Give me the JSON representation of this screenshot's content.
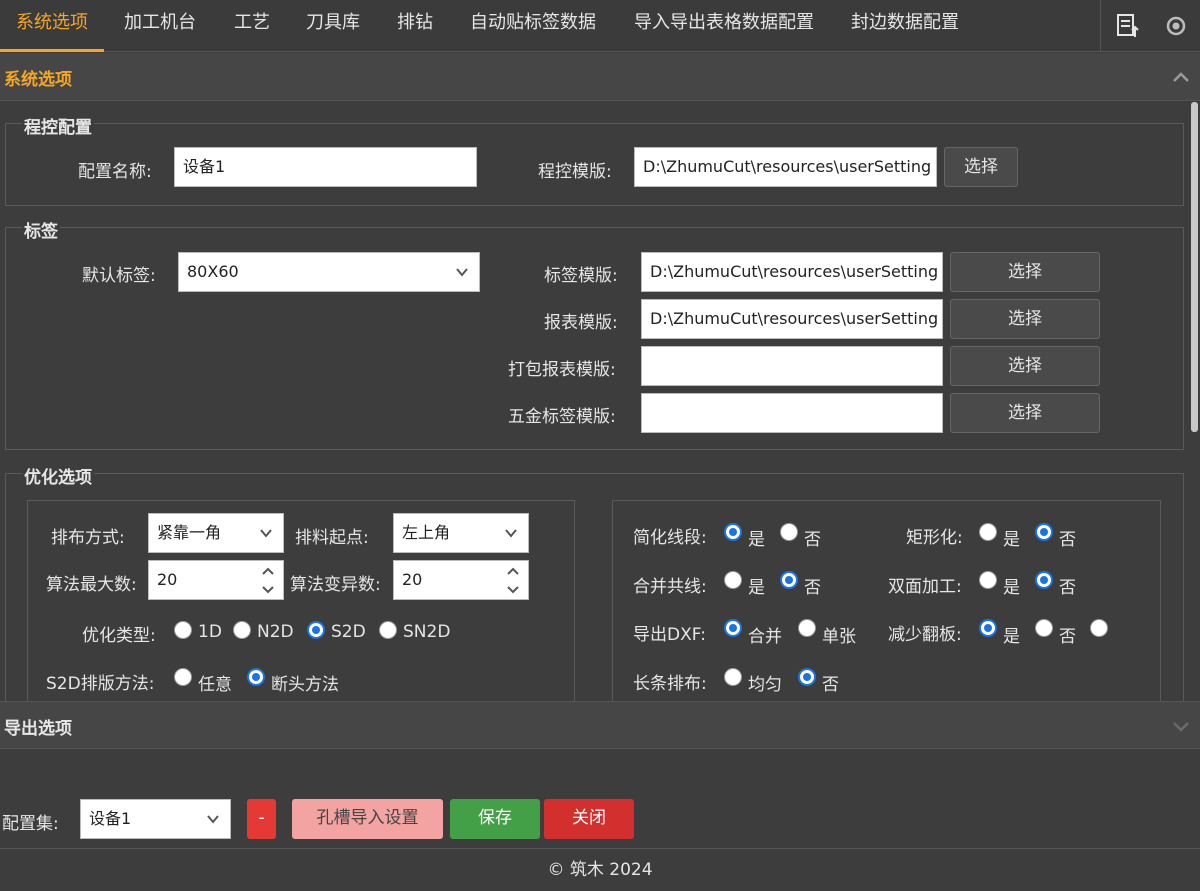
{
  "tabs": [
    {
      "label": "系统选项",
      "active": true
    },
    {
      "label": "加工机台"
    },
    {
      "label": "工艺"
    },
    {
      "label": "刀具库"
    },
    {
      "label": "排钻"
    },
    {
      "label": "自动贴标签数据"
    },
    {
      "label": "导入导出表格数据配置"
    },
    {
      "label": "封边数据配置"
    }
  ],
  "colors": {
    "accent": "#f5a623",
    "radio": "#1a73e8",
    "save": "#43a047",
    "close": "#d32f2f",
    "minus": "#e53935",
    "hole": "#f4a3a3"
  },
  "system_section": {
    "title": "系统选项",
    "program_group": {
      "title": "程控配置",
      "config_name_label": "配置名称:",
      "config_name_value": "设备1",
      "template_label": "程控模版:",
      "template_value": "D:\\ZhumuCut\\resources\\userSetting",
      "select_label": "选择"
    },
    "label_group": {
      "title": "标签",
      "default_label": "默认标签:",
      "default_value": "80X60",
      "rows": [
        {
          "label": "标签模版:",
          "value": "D:\\ZhumuCut\\resources\\userSetting",
          "button": "选择"
        },
        {
          "label": "报表模版:",
          "value": "D:\\ZhumuCut\\resources\\userSetting",
          "button": "选择"
        },
        {
          "label": "打包报表模版:",
          "value": "",
          "button": "选择"
        },
        {
          "label": "五金标签模版:",
          "value": "",
          "button": "选择"
        }
      ]
    },
    "opt_group": {
      "title": "优化选项",
      "layout_label": "排布方式:",
      "layout_value": "紧靠一角",
      "start_label": "排料起点:",
      "start_value": "左上角",
      "max_label": "算法最大数:",
      "max_value": "20",
      "var_label": "算法变异数:",
      "var_value": "20",
      "type_label": "优化类型:",
      "type_options": [
        "1D",
        "N2D",
        "S2D",
        "SN2D"
      ],
      "s2d_label": "S2D排版方法:",
      "s2d_options": [
        "任意",
        "断头方法"
      ],
      "simplify_label": "简化线段:",
      "rect_label": "矩形化:",
      "merge_label": "合并共线:",
      "double_label": "双面加工:",
      "dxf_label": "导出DXF:",
      "flip_label": "减少翻板:",
      "strip_label": "长条排布:",
      "yes": "是",
      "no": "否",
      "merge_opt": "合并",
      "single_opt": "单张",
      "even_opt": "均匀"
    }
  },
  "export_section": {
    "title": "导出选项"
  },
  "footer": {
    "config_set_label": "配置集:",
    "config_set_value": "设备1",
    "minus_label": "-",
    "hole_label": "孔槽导入设置",
    "save_label": "保存",
    "close_label": "关闭",
    "copyright": "© 筑木 2024"
  }
}
